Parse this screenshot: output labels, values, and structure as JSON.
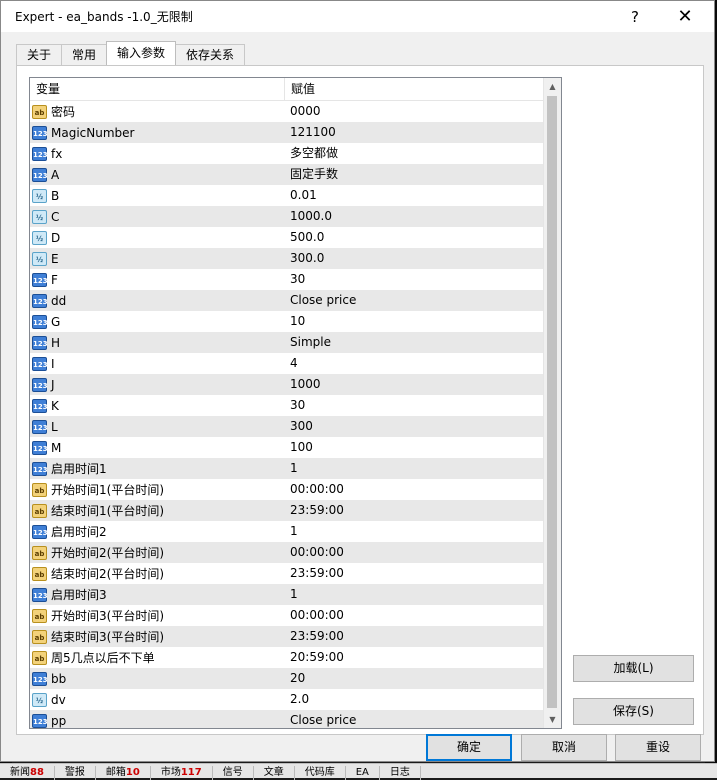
{
  "window": {
    "title": "Expert - ea_bands -1.0_无限制",
    "help_glyph": "?",
    "close_glyph": "✕"
  },
  "tabs": [
    {
      "label": "关于",
      "active": false
    },
    {
      "label": "常用",
      "active": false
    },
    {
      "label": "输入参数",
      "active": true
    },
    {
      "label": "依存关系",
      "active": false
    }
  ],
  "table": {
    "headers": {
      "variable": "变量",
      "value": "赋值"
    },
    "rows": [
      {
        "type": "string",
        "icon": "ab",
        "name": "密码",
        "value": "0000"
      },
      {
        "type": "int",
        "icon": "123",
        "name": "MagicNumber",
        "value": "121100"
      },
      {
        "type": "int",
        "icon": "123",
        "name": "fx",
        "value": "多空都做"
      },
      {
        "type": "int",
        "icon": "123",
        "name": "A",
        "value": "固定手数"
      },
      {
        "type": "double",
        "icon": "½",
        "name": "B",
        "value": "0.01"
      },
      {
        "type": "double",
        "icon": "½",
        "name": "C",
        "value": "1000.0"
      },
      {
        "type": "double",
        "icon": "½",
        "name": "D",
        "value": "500.0"
      },
      {
        "type": "double",
        "icon": "½",
        "name": "E",
        "value": "300.0"
      },
      {
        "type": "int",
        "icon": "123",
        "name": "F",
        "value": "30"
      },
      {
        "type": "int",
        "icon": "123",
        "name": "dd",
        "value": "Close price"
      },
      {
        "type": "int",
        "icon": "123",
        "name": "G",
        "value": "10"
      },
      {
        "type": "int",
        "icon": "123",
        "name": "H",
        "value": "Simple"
      },
      {
        "type": "int",
        "icon": "123",
        "name": "I",
        "value": "4"
      },
      {
        "type": "int",
        "icon": "123",
        "name": "J",
        "value": "1000"
      },
      {
        "type": "int",
        "icon": "123",
        "name": "K",
        "value": "30"
      },
      {
        "type": "int",
        "icon": "123",
        "name": "L",
        "value": "300"
      },
      {
        "type": "int",
        "icon": "123",
        "name": "M",
        "value": "100"
      },
      {
        "type": "int",
        "icon": "123",
        "name": "启用时间1",
        "value": "1"
      },
      {
        "type": "string",
        "icon": "ab",
        "name": "开始时间1(平台时间)",
        "value": "00:00:00"
      },
      {
        "type": "string",
        "icon": "ab",
        "name": "结束时间1(平台时间)",
        "value": "23:59:00"
      },
      {
        "type": "int",
        "icon": "123",
        "name": "启用时间2",
        "value": "1"
      },
      {
        "type": "string",
        "icon": "ab",
        "name": "开始时间2(平台时间)",
        "value": "00:00:00"
      },
      {
        "type": "string",
        "icon": "ab",
        "name": "结束时间2(平台时间)",
        "value": "23:59:00"
      },
      {
        "type": "int",
        "icon": "123",
        "name": "启用时间3",
        "value": "1"
      },
      {
        "type": "string",
        "icon": "ab",
        "name": "开始时间3(平台时间)",
        "value": "00:00:00"
      },
      {
        "type": "string",
        "icon": "ab",
        "name": "结束时间3(平台时间)",
        "value": "23:59:00"
      },
      {
        "type": "string",
        "icon": "ab",
        "name": "周5几点以后不下单",
        "value": "20:59:00"
      },
      {
        "type": "int",
        "icon": "123",
        "name": "bb",
        "value": "20"
      },
      {
        "type": "double",
        "icon": "½",
        "name": "dv",
        "value": "2.0"
      },
      {
        "type": "int",
        "icon": "123",
        "name": "pp",
        "value": "Close price"
      }
    ]
  },
  "buttons": {
    "load": "加载(L)",
    "save": "保存(S)",
    "ok": "确定",
    "cancel": "取消",
    "reset": "重设"
  },
  "background_status_tabs": [
    {
      "label": "新闻",
      "count": "88"
    },
    {
      "label": "警报",
      "count": ""
    },
    {
      "label": "邮箱",
      "count": "10"
    },
    {
      "label": "市场",
      "count": "117"
    },
    {
      "label": "信号",
      "count": ""
    },
    {
      "label": "文章",
      "count": ""
    },
    {
      "label": "代码库",
      "count": ""
    },
    {
      "label": "EA",
      "count": ""
    },
    {
      "label": "日志",
      "count": ""
    }
  ],
  "colors": {
    "dialog_bg": "#f0f0f0",
    "row_alt": "#e8e8e8",
    "default_button_border": "#0078d7"
  }
}
